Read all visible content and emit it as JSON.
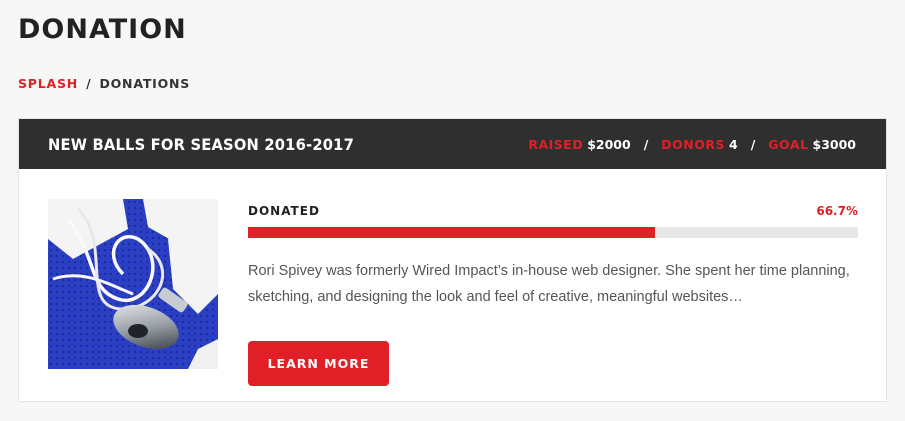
{
  "page": {
    "title": "DONATION"
  },
  "breadcrumb": {
    "home": "SPLASH",
    "separator": "/",
    "current": "DONATIONS"
  },
  "campaign": {
    "title": "NEW BALLS FOR SEASON 2016-2017",
    "stats": {
      "raised_label": "RAISED",
      "raised_value": "$2000",
      "donors_label": "DONORS",
      "donors_value": "4",
      "goal_label": "GOAL",
      "goal_value": "$3000",
      "separator": "/"
    },
    "image_icon": "whistle-photo",
    "progress": {
      "label": "DONATED",
      "percent_text": "66.7%",
      "percent": 66.7
    },
    "description": "Rori Spivey was formerly Wired Impact’s in-house web designer. She spent her time planning, sketching, and designing the look and feel of creative, meaningful websites…",
    "button_label": "LEARN MORE"
  },
  "colors": {
    "accent": "#e11f26",
    "header_bg": "#2f2f2f",
    "page_bg": "#f7f7f7",
    "track": "#e7e7e7"
  }
}
